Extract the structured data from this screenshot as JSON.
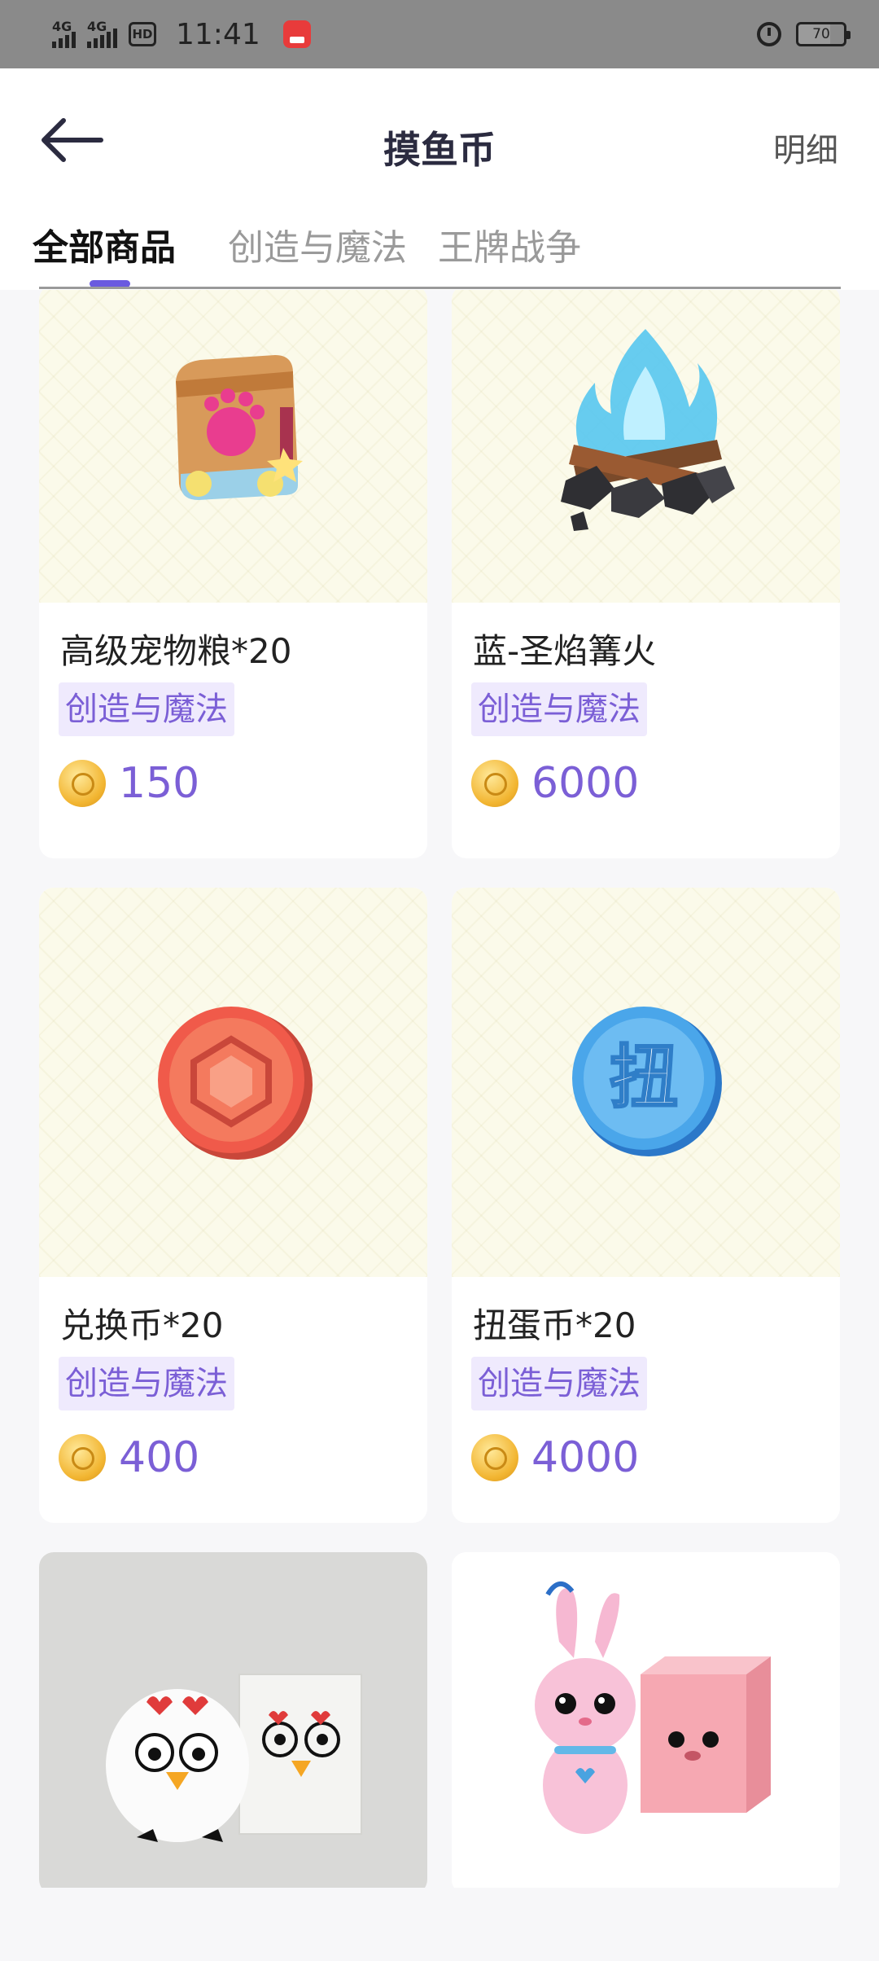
{
  "status_bar": {
    "signal_1": "4G",
    "signal_2": "4G",
    "hd": "HD",
    "time": "11:41",
    "battery": "70"
  },
  "header": {
    "title": "摸鱼币",
    "detail_label": "明细"
  },
  "tabs": [
    {
      "label": "全部商品",
      "active": true
    },
    {
      "label": "创造与魔法",
      "active": false
    },
    {
      "label": "王牌战争",
      "active": false
    }
  ],
  "products": [
    {
      "name": "高级宠物粮*20",
      "tag": "创造与魔法",
      "price": "150",
      "icon": "pet-food-bag"
    },
    {
      "name": "蓝-圣焰篝火",
      "tag": "创造与魔法",
      "price": "6000",
      "icon": "blue-campfire"
    },
    {
      "name": "兑换币*20",
      "tag": "创造与魔法",
      "price": "400",
      "icon": "exchange-coin"
    },
    {
      "name": "扭蛋币*20",
      "tag": "创造与魔法",
      "price": "4000",
      "icon": "gacha-coin",
      "icon_text": "扭"
    },
    {
      "icon": "chicken-plush-with-box"
    },
    {
      "icon": "bunny-plush-with-box"
    }
  ],
  "colors": {
    "accent": "#7b5fd6",
    "tag_bg": "#efeafd",
    "tab_underline": "#6a5ae0"
  }
}
